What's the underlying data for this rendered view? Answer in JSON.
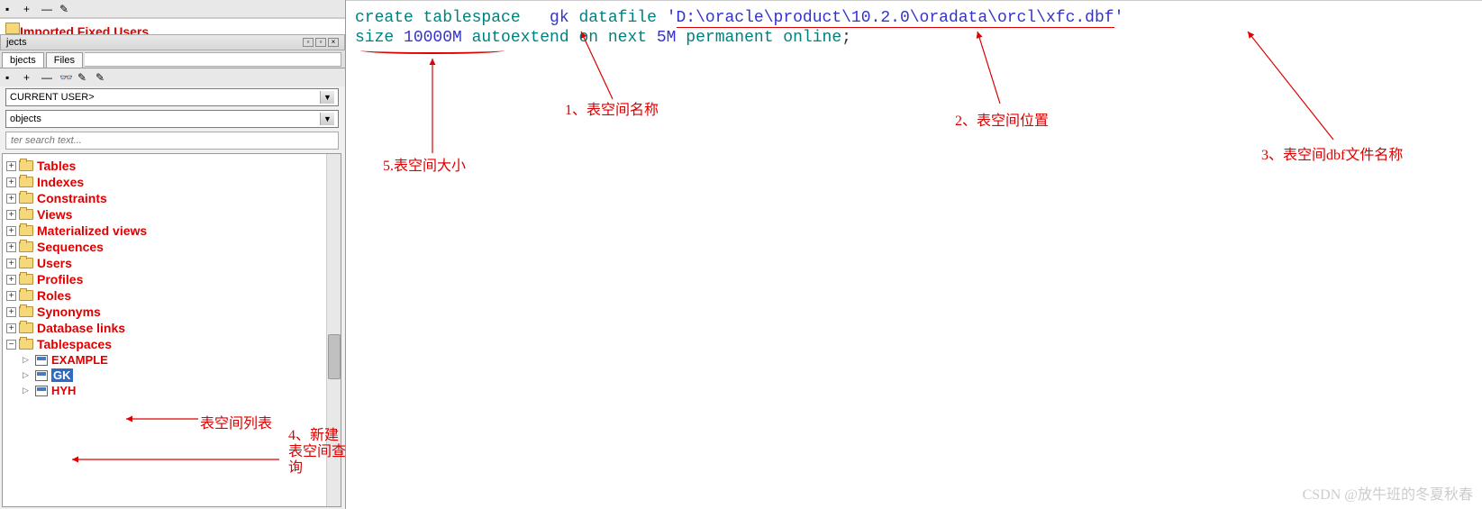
{
  "sidebar": {
    "cutoff_item": "Imported Fixed Users",
    "panel_title": "jects",
    "tabs": {
      "objects": "bjects",
      "files": "Files"
    },
    "dropdown_user": "CURRENT USER>",
    "dropdown_filter": "objects",
    "search_placeholder": "ter search text...",
    "tree": [
      {
        "label": "Tables",
        "type": "folder"
      },
      {
        "label": "Indexes",
        "type": "folder"
      },
      {
        "label": "Constraints",
        "type": "folder"
      },
      {
        "label": "Views",
        "type": "folder"
      },
      {
        "label": "Materialized views",
        "type": "folder"
      },
      {
        "label": "Sequences",
        "type": "folder"
      },
      {
        "label": "Users",
        "type": "folder"
      },
      {
        "label": "Profiles",
        "type": "folder"
      },
      {
        "label": "Roles",
        "type": "folder"
      },
      {
        "label": "Synonyms",
        "type": "folder"
      },
      {
        "label": "Database links",
        "type": "folder"
      },
      {
        "label": "Tablespaces",
        "type": "folder",
        "expanded": true,
        "children": [
          {
            "label": "EXAMPLE"
          },
          {
            "label": "GK",
            "selected": true
          },
          {
            "label": "HYH"
          }
        ]
      }
    ]
  },
  "sql": {
    "line1": {
      "kw1": "create tablespace   ",
      "name": "gk",
      "kw2": " datafile ",
      "q1": "'",
      "path": "D:\\oracle\\product\\10.2.0\\oradata\\orcl\\",
      "fname": "xfc.dbf",
      "q2": "'"
    },
    "line2": {
      "kw1": "size ",
      "size": "10000M",
      "kw2": " autoextend on next ",
      "next": "5M",
      "kw3": " permanent online",
      "semi": ";"
    }
  },
  "annotations": {
    "a1": "1、表空间名称",
    "a2": "2、表空间位置",
    "a3": "3、表空间dbf文件名称",
    "a4_l1": "4、新建",
    "a4_l2": "表空间查",
    "a4_l3": "询",
    "a5": "5.表空间大小",
    "list_label": "表空间列表"
  },
  "watermark": "CSDN @放牛班的冬夏秋春"
}
